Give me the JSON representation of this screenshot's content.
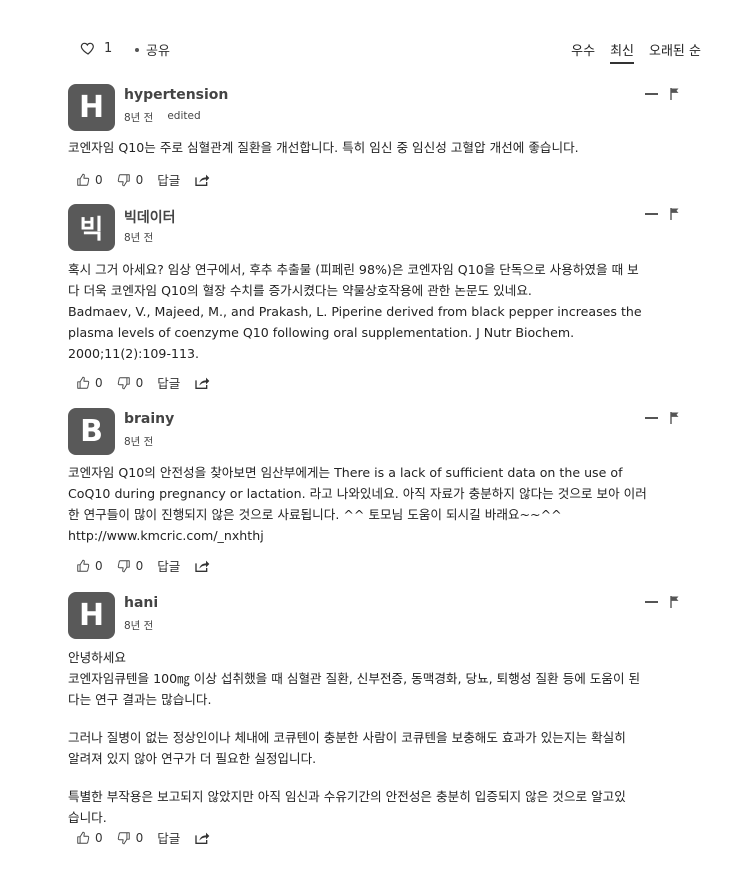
{
  "topbar": {
    "like_count": "1",
    "share_label": "공유",
    "sort": [
      "우수",
      "최신",
      "오래된 순"
    ]
  },
  "comments": [
    {
      "avatar": "H",
      "author": "hypertension",
      "time": "8년 전",
      "edited": "edited",
      "lines": [
        "코엔자임 Q10는 주로 심혈관계 질환을 개선합니다. 특히 임신 중 임신성 고혈압 개선에 좋습니다."
      ],
      "likes": "0",
      "dislikes": "0",
      "reply": "답글"
    },
    {
      "avatar": "빅",
      "author": "빅데이터",
      "time": "8년 전",
      "lines": [
        "혹시 그거 아세요? 임상 연구에서, 후추 추출물 (피페린 98%)은 코엔자임 Q10을 단독으로 사용하였을 때 보",
        "다 더욱 코엔자임 Q10의 혈장 수치를 증가시켰다는 약물상호작용에 관한 논문도 있네요.",
        "Badmaev, V., Majeed, M., and Prakash, L. Piperine derived from black pepper increases the",
        "plasma levels of coenzyme Q10 following oral supplementation. J Nutr Biochem.",
        "2000;11(2):109-113."
      ],
      "likes": "0",
      "dislikes": "0",
      "reply": "답글"
    },
    {
      "avatar": "B",
      "author": "brainy",
      "time": "8년 전",
      "lines": [
        "코엔자임 Q10의 안전성을 찾아보면 임산부에게는 There is a lack of sufficient data on the use of",
        "CoQ10 during pregnancy or lactation. 라고 나와있네요. 아직 자료가 충분하지 않다는 것으로 보아 이러",
        "한 연구들이 많이 진행되지 않은 것으로 사료됩니다. ^^ 토모님 도움이 되시길 바래요~~^^",
        "http://www.kmcric.com/_nxhthj"
      ],
      "likes": "0",
      "dislikes": "0",
      "reply": "답글"
    },
    {
      "avatar": "H",
      "author": "hani",
      "time": "8년 전",
      "paragraphs": [
        [
          "안녕하세요",
          "코엔자임큐텐을 100㎎ 이상 섭취했을 때 심혈관 질환, 신부전증, 동맥경화, 당뇨, 퇴행성 질환 등에 도움이 된",
          "다는 연구 결과는 많습니다."
        ],
        [
          "그러나 질병이 없는 정상인이나 체내에 코큐텐이 충분한 사람이 코큐텐을 보충해도 효과가 있는지는 확실히",
          "알려져 있지 않아 연구가 더 필요한 실정입니다."
        ],
        [
          "특별한 부작용은 보고되지 않았지만 아직 임신과 수유기간의 안전성은 충분히 입증되지 않은 것으로 알고있",
          "습니다."
        ]
      ],
      "likes": "0",
      "dislikes": "0",
      "reply": "답글"
    }
  ]
}
